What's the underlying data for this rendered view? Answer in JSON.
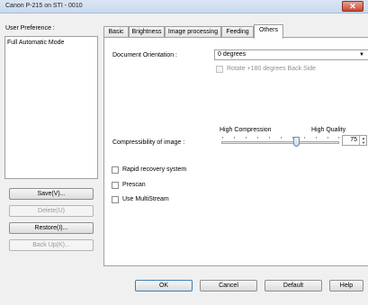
{
  "window": {
    "title": "Canon P-215 on STI - 0010",
    "close_glyph": "✕"
  },
  "sidebar": {
    "label": "User Preference :",
    "items": [
      "Full Automatic Mode"
    ],
    "buttons": {
      "save": "Save(V)...",
      "delete": "Delete(U)",
      "restore": "Restore(I)...",
      "backup": "Back Up(K)..."
    }
  },
  "tabs": [
    {
      "label": "Basic",
      "active": false
    },
    {
      "label": "Brightness",
      "active": false
    },
    {
      "label": "Image processing",
      "active": false
    },
    {
      "label": "Feeding",
      "active": false
    },
    {
      "label": "Others",
      "active": true
    }
  ],
  "others": {
    "orientation_label": "Document Orientation :",
    "orientation_value": "0 degrees",
    "rotate_label": "Rotate +180 degrees Back Side",
    "rotate_checked": false,
    "compress_label": "Compressibility of image :",
    "slider_low": "High Compression",
    "slider_high": "High Quality",
    "slider_value": "75",
    "rapid_label": "Rapid recovery system",
    "prescan_label": "Prescan",
    "multistream_label": "Use MultiStream"
  },
  "footer": {
    "ok": "OK",
    "cancel": "Cancel",
    "default": "Default",
    "help": "Help"
  }
}
